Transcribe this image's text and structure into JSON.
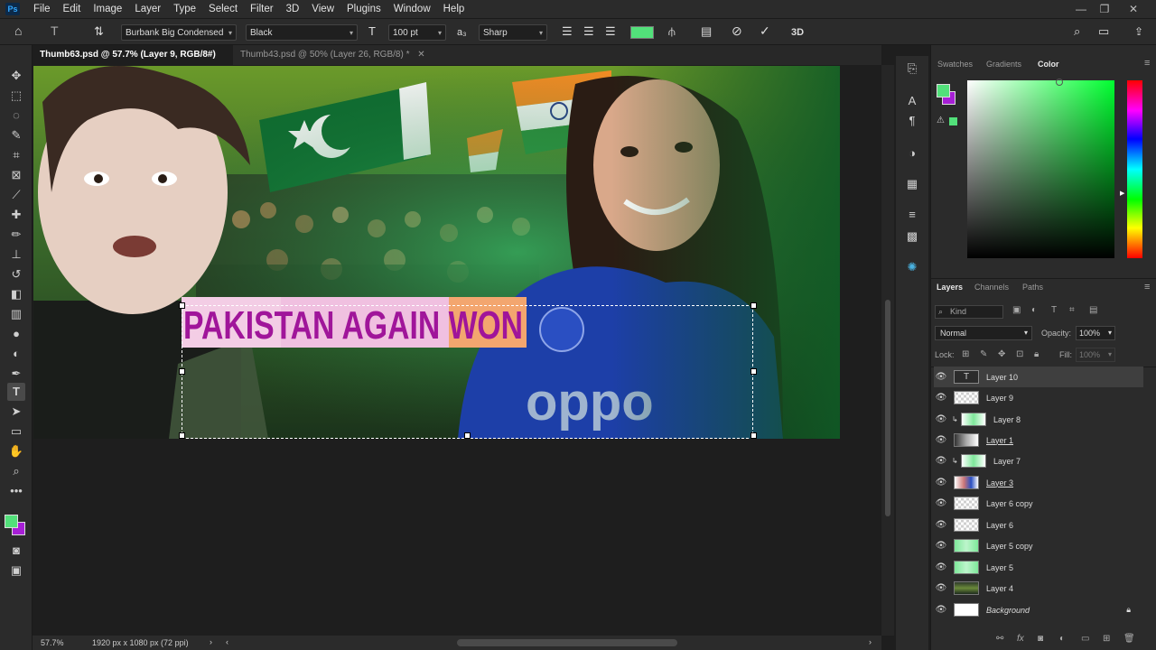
{
  "app": {
    "logo": "Ps"
  },
  "menu": [
    "File",
    "Edit",
    "Image",
    "Layer",
    "Type",
    "Select",
    "Filter",
    "3D",
    "View",
    "Plugins",
    "Window",
    "Help"
  ],
  "options": {
    "font_family": "Burbank Big Condensed",
    "font_style": "Black",
    "font_size": "100 pt",
    "antialias": "Sharp",
    "text_color": "#52e07a",
    "right_label": "3D"
  },
  "tabs": [
    {
      "label": "Thumb63.psd @ 57.7% (Layer 9, RGB/8#)",
      "active": true
    },
    {
      "label": "Thumb43.psd @ 50% (Layer 26, RGB/8) *",
      "active": false
    }
  ],
  "canvas": {
    "headline": "PAKISTAN AGAIN WON",
    "headline_color": "#a0159a",
    "jersey_text": "oppo"
  },
  "status": {
    "zoom": "57.7%",
    "doc_info": "1920 px x 1080 px (72 ppi)"
  },
  "color_panel": {
    "tabs": [
      "Swatches",
      "Gradients",
      "Color"
    ],
    "active": "Color",
    "fg": "#52e07a",
    "bg": "#a71fd6"
  },
  "layers_panel": {
    "tabs": [
      "Layers",
      "Channels",
      "Paths"
    ],
    "filter_kind": "Kind",
    "blend_mode": "Normal",
    "opacity_label": "Opacity:",
    "opacity_value": "100%",
    "lock_label": "Lock:",
    "fill_label": "Fill:",
    "fill_value": "100%",
    "layers": [
      {
        "name": "Layer 10",
        "type": "text",
        "selected": true
      },
      {
        "name": "Layer 9",
        "type": "pixel"
      },
      {
        "name": "Layer 8",
        "type": "clip-green"
      },
      {
        "name": "Layer 1",
        "type": "photo"
      },
      {
        "name": "Layer 7",
        "type": "clip-green"
      },
      {
        "name": "Layer 3",
        "type": "photo"
      },
      {
        "name": "Layer 6 copy",
        "type": "pixel"
      },
      {
        "name": "Layer 6",
        "type": "pixel"
      },
      {
        "name": "Layer 5 copy",
        "type": "green"
      },
      {
        "name": "Layer 5",
        "type": "green"
      },
      {
        "name": "Layer 4",
        "type": "photo"
      },
      {
        "name": "Background",
        "type": "white",
        "locked": true
      }
    ]
  }
}
